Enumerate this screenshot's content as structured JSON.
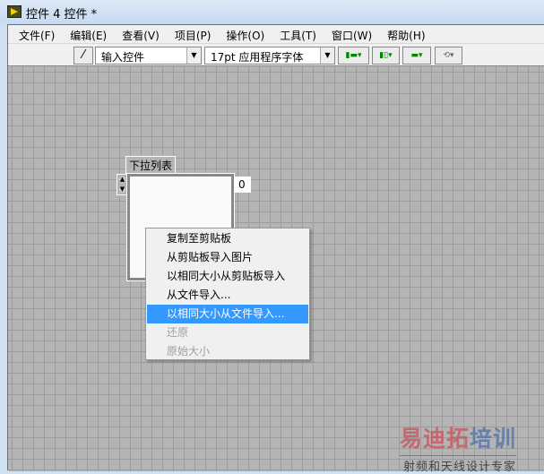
{
  "window": {
    "title": "控件 4 控件 *"
  },
  "menu": [
    "文件(F)",
    "编辑(E)",
    "查看(V)",
    "项目(P)",
    "操作(O)",
    "工具(T)",
    "窗口(W)",
    "帮助(H)"
  ],
  "toolbar": {
    "control_type": "输入控件",
    "font": "17pt 应用程序字体"
  },
  "control": {
    "label": "下拉列表",
    "index": "0"
  },
  "context_menu": [
    {
      "label": "复制至剪贴板",
      "state": "normal"
    },
    {
      "label": "从剪贴板导入图片",
      "state": "normal"
    },
    {
      "label": "以相同大小从剪贴板导入",
      "state": "normal"
    },
    {
      "label": "从文件导入...",
      "state": "normal"
    },
    {
      "label": "以相同大小从文件导入...",
      "state": "highlighted"
    },
    {
      "label": "还原",
      "state": "disabled"
    },
    {
      "label": "原始大小",
      "state": "disabled"
    }
  ],
  "watermark": {
    "brand_a": "易迪拓",
    "brand_b": "培训",
    "tagline": "射频和天线设计专家"
  }
}
